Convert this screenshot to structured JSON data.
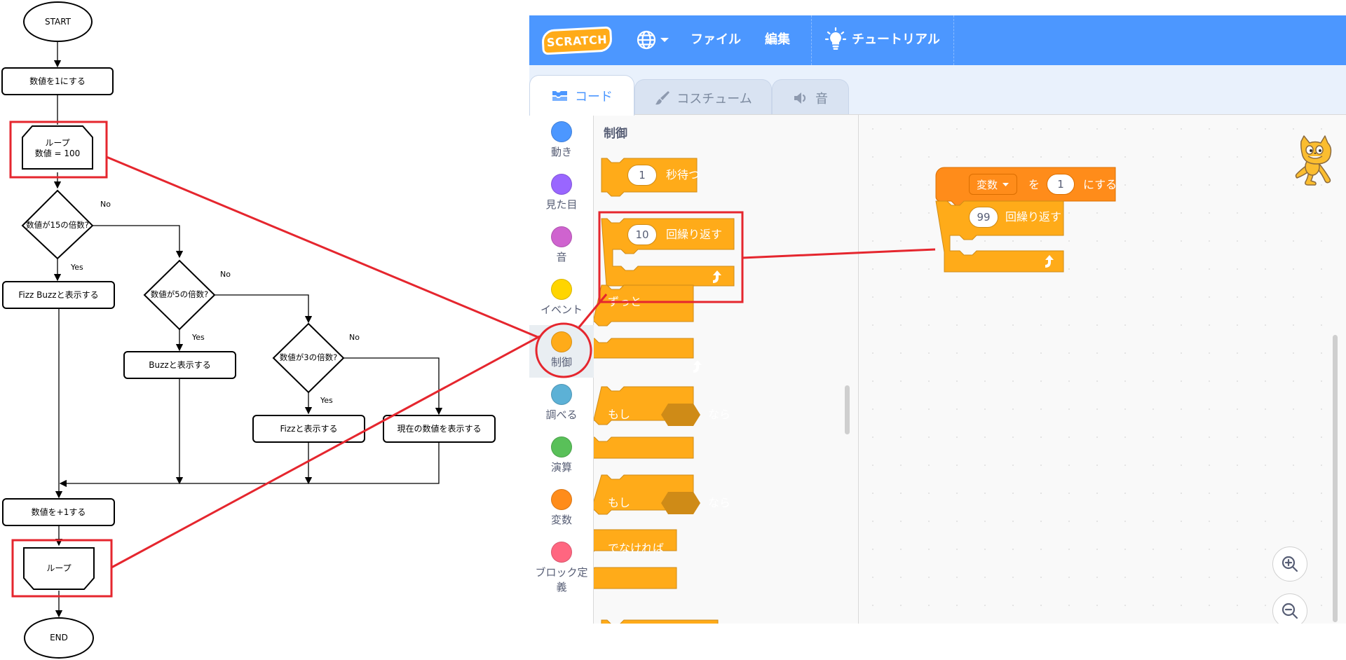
{
  "flowchart": {
    "start": "START",
    "init": "数値を1にする",
    "loop_start": {
      "line1": "ループ",
      "line2": "数値 = 100"
    },
    "decision15": "数値が15の倍数?",
    "decision5": "数値が5の倍数?",
    "decision3": "数値が3の倍数?",
    "fizzbuzz": "Fizz Buzzと表示する",
    "buzz": "Buzzと表示する",
    "fizz": "Fizzと表示する",
    "number": "現在の数値を表示する",
    "increment": "数値を+1する",
    "loop_end": "ループ",
    "end": "END",
    "labels": {
      "yes": "Yes",
      "no": "No"
    }
  },
  "scratch": {
    "logo": "SCRATCH",
    "menu": {
      "file": "ファイル",
      "edit": "編集",
      "tutorial": "チュートリアル"
    },
    "tabs": {
      "code": "コード",
      "costume": "コスチューム",
      "sound": "音"
    },
    "categories": [
      {
        "label": "動き",
        "color": "#4c97ff"
      },
      {
        "label": "見た目",
        "color": "#9966ff"
      },
      {
        "label": "音",
        "color": "#cf63cf"
      },
      {
        "label": "イベント",
        "color": "#ffd500"
      },
      {
        "label": "制御",
        "color": "#ffab19"
      },
      {
        "label": "調べる",
        "color": "#5cb1d6"
      },
      {
        "label": "演算",
        "color": "#59c059"
      },
      {
        "label": "変数",
        "color": "#ff8c1a"
      },
      {
        "label": "ブロック定義",
        "color": "#ff6680"
      }
    ],
    "palette": {
      "title": "制御",
      "wait": {
        "value": "1",
        "label": "秒待つ"
      },
      "repeat": {
        "value": "10",
        "label": "回繰り返す"
      },
      "forever": {
        "label": "ずっと"
      },
      "if_then": {
        "if": "もし",
        "then": "なら"
      },
      "if_else": {
        "if": "もし",
        "then": "なら",
        "else": "でなければ"
      }
    },
    "script": {
      "set_var": {
        "variable": "変数",
        "to": "を",
        "value": "1",
        "suffix": "にする"
      },
      "repeat": {
        "value": "99",
        "label": "回繰り返す"
      }
    },
    "colors": {
      "control": "#ffab19",
      "control_dark": "#cf8b17",
      "variables": "#ff8c1a",
      "menu_bar": "#4c97ff",
      "annotation": "#e5262e"
    }
  }
}
